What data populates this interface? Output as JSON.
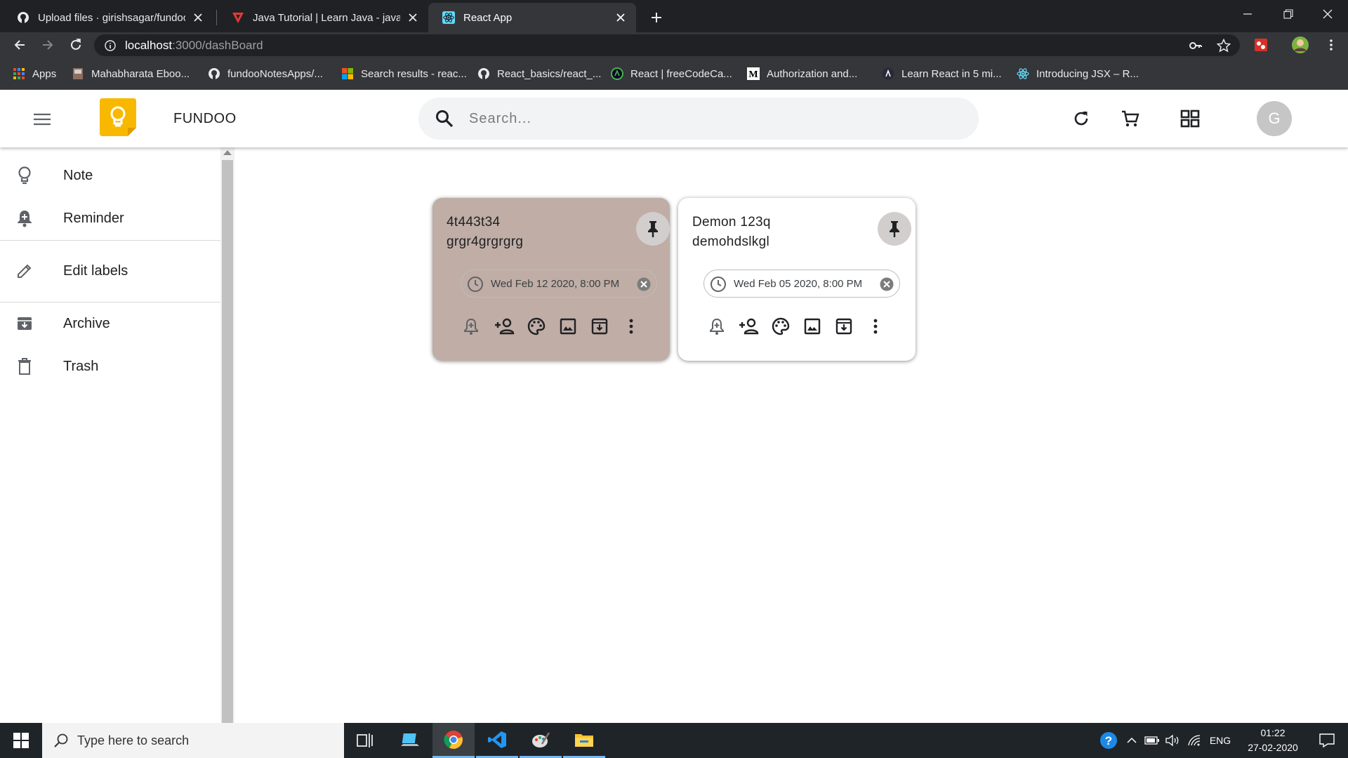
{
  "browser": {
    "tabs": [
      {
        "title": "Upload files · girishsagar/fundoo",
        "favicon": "github-icon",
        "active": false
      },
      {
        "title": "Java Tutorial | Learn Java - javatpoint",
        "favicon": "javatpoint-icon",
        "active": false
      },
      {
        "title": "React App",
        "favicon": "react-icon",
        "active": true
      }
    ],
    "address": {
      "host": "localhost",
      "path": ":3000/dashBoard"
    },
    "bookmarks": [
      {
        "label": "Apps",
        "icon": "apps-grid-icon"
      },
      {
        "label": "Mahabharata Eboo...",
        "icon": "book-icon"
      },
      {
        "label": "fundooNotesApps/...",
        "icon": "github-icon"
      },
      {
        "label": "Search results - reac...",
        "icon": "microsoft-icon"
      },
      {
        "label": "React_basics/react_...",
        "icon": "github-icon"
      },
      {
        "label": "React | freeCodeCa...",
        "icon": "freecodecamp-icon"
      },
      {
        "label": "Authorization and...",
        "icon": "medium-icon"
      },
      {
        "label": "Learn React in 5 mi...",
        "icon": "scrimba-icon"
      },
      {
        "label": "Introducing JSX – R...",
        "icon": "react-icon"
      }
    ]
  },
  "app": {
    "brand": "FUNDOO",
    "search_placeholder": "Search...",
    "avatar_initial": "G",
    "colors": {
      "accent": "#f9b800",
      "note_brown": "#bfada6",
      "note_white": "#ffffff"
    }
  },
  "sidebar": {
    "items": [
      {
        "label": "Note",
        "icon": "lightbulb-icon"
      },
      {
        "label": "Reminder",
        "icon": "bell-plus-icon"
      },
      {
        "label": "Edit labels",
        "icon": "pencil-icon"
      },
      {
        "label": "Archive",
        "icon": "archive-icon"
      },
      {
        "label": "Trash",
        "icon": "trash-icon"
      }
    ]
  },
  "notes": [
    {
      "title": "4t443t34",
      "body": "grgr4grgrgrg",
      "reminder": "Wed Feb 12 2020, 8:00 PM",
      "color": "#bfada6"
    },
    {
      "title": "Demon 123q",
      "body": "demohdslkgl",
      "reminder": "Wed Feb 05 2020, 8:00 PM",
      "color": "#ffffff"
    }
  ],
  "taskbar": {
    "search_placeholder": "Type here to search",
    "language": "ENG",
    "time": "01:22",
    "date": "27-02-2020"
  }
}
